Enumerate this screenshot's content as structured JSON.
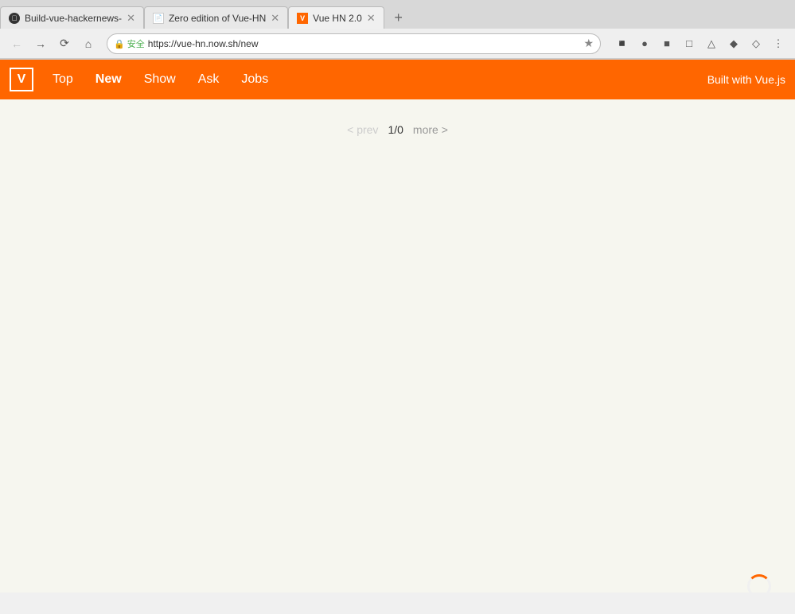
{
  "browser": {
    "tabs": [
      {
        "id": "tab1",
        "title": "Build-vue-hackernews-",
        "favicon": "github",
        "active": false
      },
      {
        "id": "tab2",
        "title": "Zero edition of Vue-HN",
        "favicon": "doc",
        "active": false
      },
      {
        "id": "tab3",
        "title": "Vue HN 2.0",
        "favicon": "vue",
        "active": true
      }
    ],
    "address": "https://vue-hn.now.sh/new",
    "security_label": "安全"
  },
  "navbar": {
    "logo_text": "V",
    "links": [
      {
        "id": "top",
        "label": "Top",
        "active": false
      },
      {
        "id": "new",
        "label": "New",
        "active": true
      },
      {
        "id": "show",
        "label": "Show",
        "active": false
      },
      {
        "id": "ask",
        "label": "Ask",
        "active": false
      },
      {
        "id": "jobs",
        "label": "Jobs",
        "active": false
      }
    ],
    "built_with": "Built with Vue.js"
  },
  "pagination": {
    "prev_label": "< prev",
    "current": "1/0",
    "more_label": "more >"
  }
}
